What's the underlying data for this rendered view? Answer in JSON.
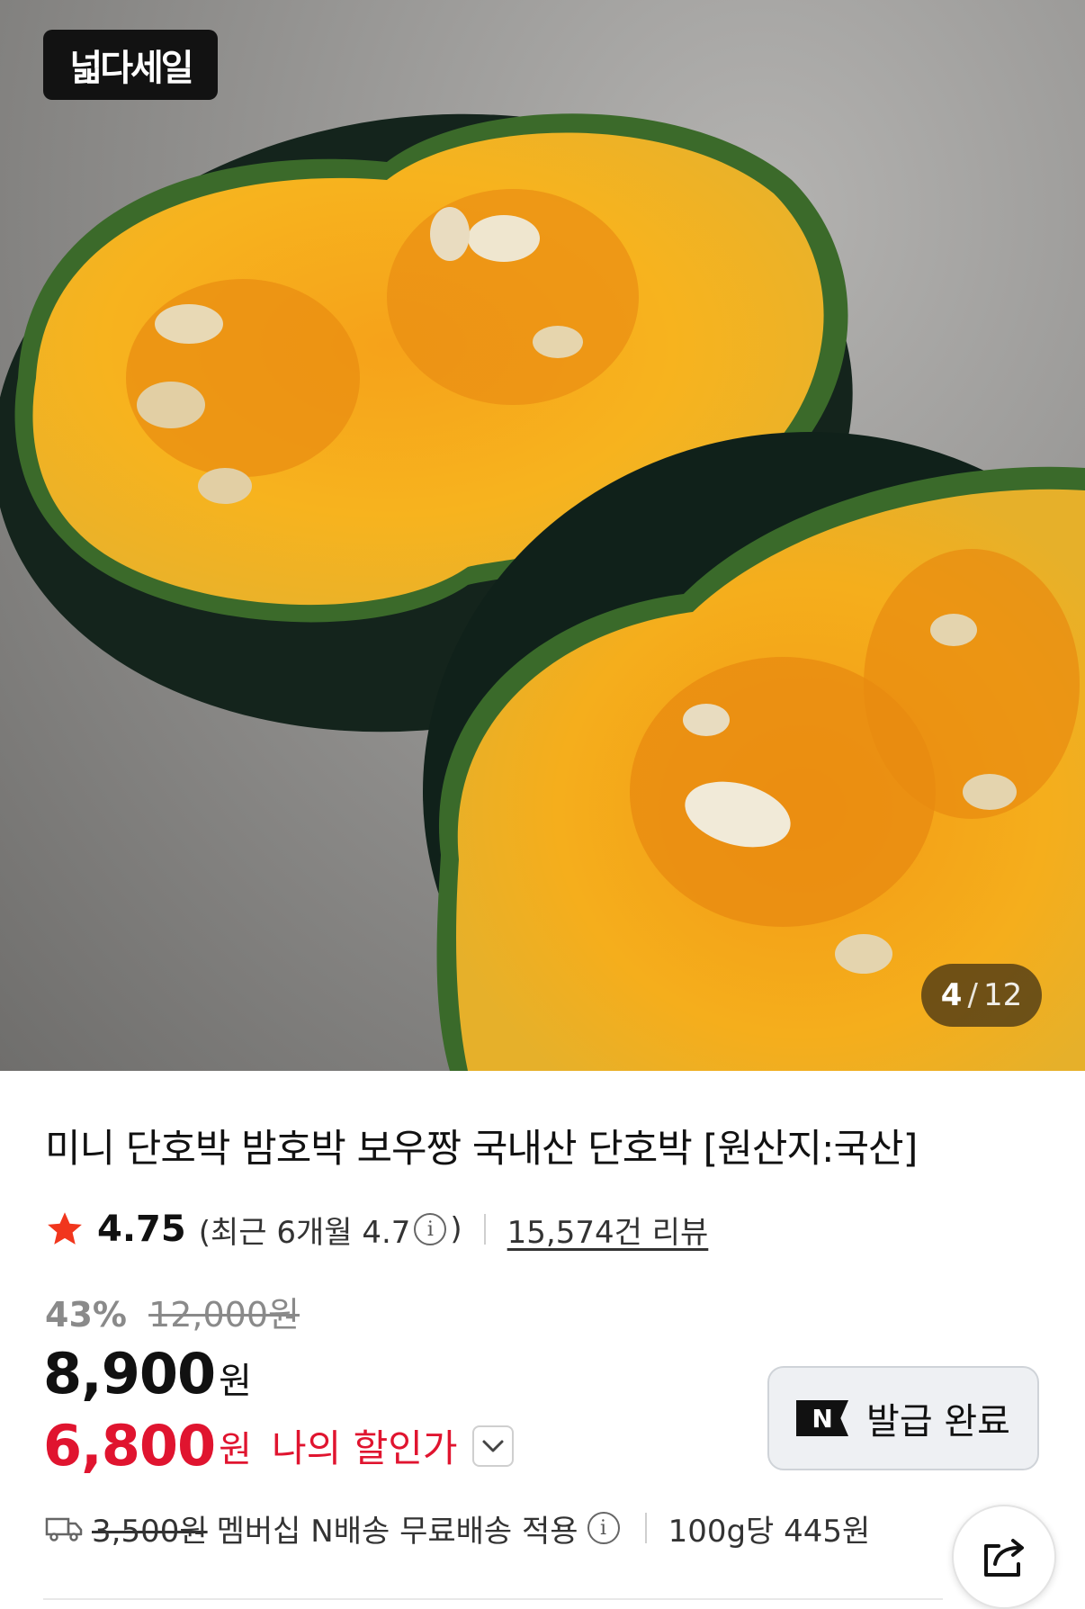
{
  "hero": {
    "badge_label": "넓다세일",
    "counter": {
      "current": "4",
      "separator": "/",
      "total": "12"
    }
  },
  "product": {
    "title": "미니 단호박 밤호박 보우짱 국내산 단호박 [원산지:국산]"
  },
  "rating": {
    "score": "4.75",
    "recent_prefix": "(최근 6개월 4.7",
    "info_glyph": "i",
    "recent_suffix": ")",
    "review_count": "15,574건 리뷰",
    "star_color": "#f1361d"
  },
  "pricing": {
    "discount_rate": "43%",
    "original_price": "12,000원",
    "sale_price": "8,900",
    "sale_unit": "원",
    "my_price": "6,800",
    "my_price_unit": "원",
    "my_price_label": "나의 할인가",
    "accent_color": "#e0142f"
  },
  "coupon": {
    "logo": "N",
    "label": "발급 완료"
  },
  "shipping": {
    "original_fee": "3,500원",
    "description": "멤버십 N배송 무료배송 적용",
    "info_glyph": "i",
    "unit_price": "100g당 445원"
  },
  "icons": {
    "star": "star-icon",
    "info": "info-icon",
    "dropdown": "chevron-down-icon",
    "truck": "truck-icon",
    "share": "share-icon"
  }
}
